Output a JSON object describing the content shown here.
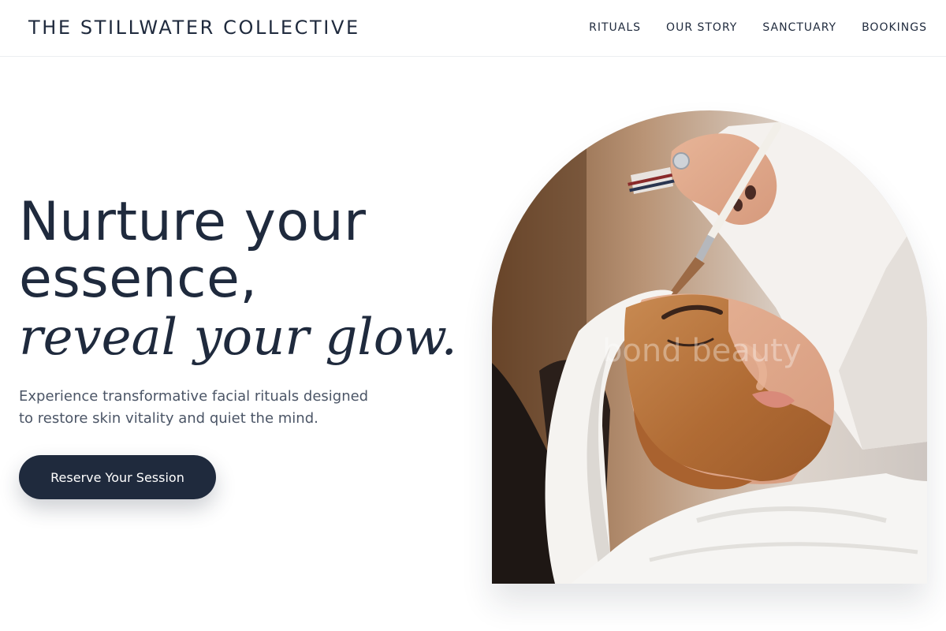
{
  "header": {
    "brand": "THE STILLWATER COLLECTIVE",
    "nav": [
      {
        "label": "RITUALS"
      },
      {
        "label": "OUR STORY"
      },
      {
        "label": "SANCTUARY"
      },
      {
        "label": "BOOKINGS"
      }
    ]
  },
  "hero": {
    "title_line_1": "Nurture your",
    "title_line_2": "essence,",
    "title_italic": "reveal your glow.",
    "subtitle_line_1": "Experience transformative facial rituals designed",
    "subtitle_line_2": "to restore skin vitality and quiet the mind.",
    "cta_label": "Reserve Your Session"
  },
  "photo": {
    "watermark": "bond beauty"
  },
  "colors": {
    "ink": "#1f2a3d",
    "muted_text": "#4b5566",
    "cta_background": "#1f2a3d",
    "cta_text": "#ffffff",
    "background": "#ffffff",
    "clay_mask": "#b8753f"
  }
}
